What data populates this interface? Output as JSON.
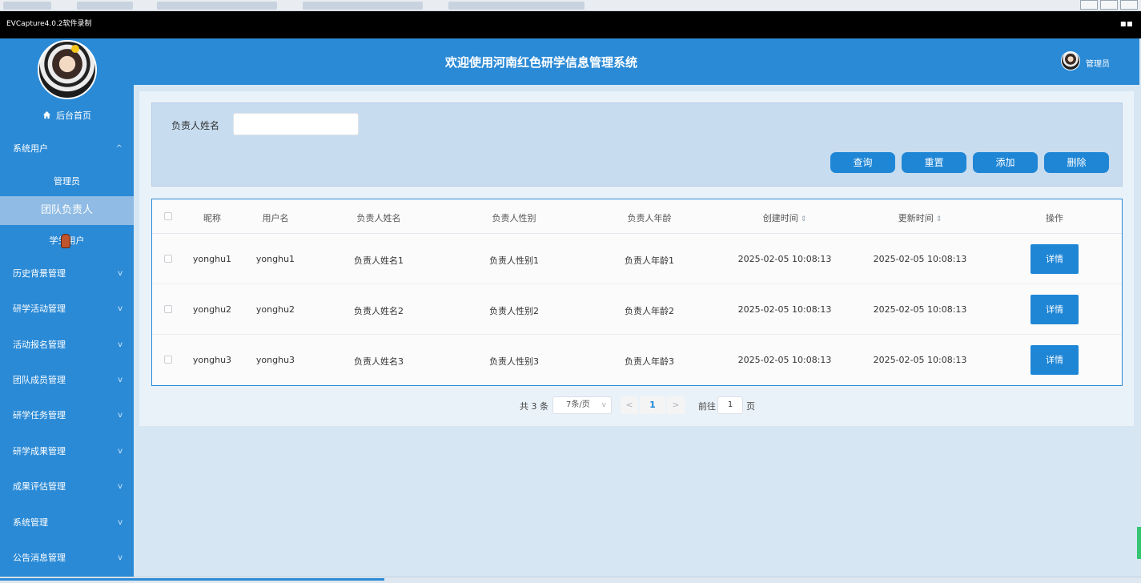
{
  "capture_title": "EVCapture4.0.2软件录制",
  "header": {
    "title": "欢迎使用河南红色研学信息管理系统",
    "admin_label": "管理员"
  },
  "sidebar": {
    "home_label": "后台首页",
    "items": [
      {
        "label": "系统用户",
        "chevron": "^"
      },
      {
        "label": "历史背景管理",
        "chevron": "v"
      },
      {
        "label": "研学活动管理",
        "chevron": "v"
      },
      {
        "label": "活动报名管理",
        "chevron": "v"
      },
      {
        "label": "团队成员管理",
        "chevron": "v"
      },
      {
        "label": "研学任务管理",
        "chevron": "v"
      },
      {
        "label": "研学成果管理",
        "chevron": "v"
      },
      {
        "label": "成果评估管理",
        "chevron": "v"
      },
      {
        "label": "系统管理",
        "chevron": "v"
      },
      {
        "label": "公告消息管理",
        "chevron": "v"
      }
    ],
    "sub_items": [
      {
        "label": "管理员"
      },
      {
        "label": "团队负责人"
      },
      {
        "label": "学生用户"
      }
    ]
  },
  "search": {
    "label": "负责人姓名",
    "value": "",
    "placeholder": ""
  },
  "buttons": {
    "query": "查询",
    "reset": "重置",
    "add": "添加",
    "delete": "删除"
  },
  "table": {
    "headers": [
      "昵称",
      "用户名",
      "负责人姓名",
      "负责人性别",
      "负责人年龄",
      "创建时间",
      "更新时间",
      "操作"
    ],
    "sort_icon": "⇕",
    "rows": [
      {
        "nickname": "yonghu1",
        "username": "yonghu1",
        "name": "负责人姓名1",
        "gender": "负责人性别1",
        "age": "负责人年龄1",
        "created": "2025-02-05 10:08:13",
        "updated": "2025-02-05 10:08:13",
        "action": "详情"
      },
      {
        "nickname": "yonghu2",
        "username": "yonghu2",
        "name": "负责人姓名2",
        "gender": "负责人性别2",
        "age": "负责人年龄2",
        "created": "2025-02-05 10:08:13",
        "updated": "2025-02-05 10:08:13",
        "action": "详情"
      },
      {
        "nickname": "yonghu3",
        "username": "yonghu3",
        "name": "负责人姓名3",
        "gender": "负责人性别3",
        "age": "负责人年龄3",
        "created": "2025-02-05 10:08:13",
        "updated": "2025-02-05 10:08:13",
        "action": "详情"
      }
    ]
  },
  "pagination": {
    "total": "共 3 条",
    "page_size": "7条/页",
    "prev": "<",
    "current": "1",
    "next": ">",
    "goto_label": "前往",
    "goto_value": "1",
    "page_suffix": "页"
  },
  "colors": {
    "primary": "#2a8ad6",
    "button": "#1f86d6",
    "active_sub": "#8fbbe4"
  }
}
